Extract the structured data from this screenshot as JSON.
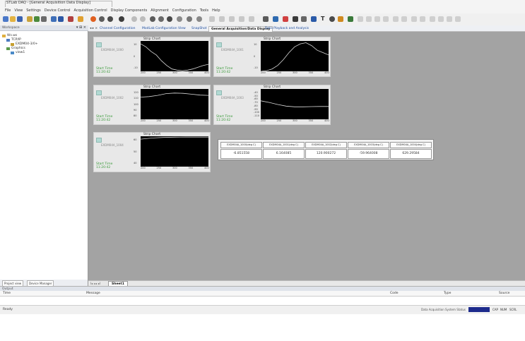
{
  "window": {
    "title": "STLab DAQ - [General Acquisition Data Display]"
  },
  "menu": [
    "File",
    "View",
    "Settings",
    "Device Control",
    "Acquisition Control",
    "Display Components",
    "Alignment",
    "Configuration",
    "Tools",
    "Help"
  ],
  "toolbar_icons": [
    "new-icon",
    "open-icon",
    "save-icon",
    "device-icon",
    "instrument-icon",
    "graph-icon",
    "grid-icon",
    "record-icon",
    "gauge-icon",
    "gauge-icon",
    "gauge-icon",
    "gauge-icon",
    "gauge-icon",
    "gauge-icon",
    "gauge-icon",
    "gauge-icon",
    "gauge-icon",
    "gauge-icon",
    "gauge-icon",
    "align-icon",
    "align-icon",
    "align-icon",
    "align-icon",
    "text-icon",
    "settings-icon",
    "indicator-icon",
    "meter-icon"
  ],
  "left_panel": {
    "header": "Workspace",
    "tree": [
      {
        "label": "Ws.ws"
      },
      {
        "label": "TCP/IP"
      },
      {
        "label": "EXDM04-3/0+"
      },
      {
        "label": "Graphics"
      },
      {
        "label": "view1"
      }
    ],
    "bottom_tabs": [
      "Project view",
      "Device Manager"
    ]
  },
  "doc_tabs": [
    {
      "label": "Channel Configuration"
    },
    {
      "label": "ModLab Configuration View"
    },
    {
      "label": "SnapShot"
    },
    {
      "label": "General Acquisition/Data Display",
      "active": true
    },
    {
      "label": "Data Playback and Analysis"
    }
  ],
  "charts": [
    {
      "title": "Strip Chart",
      "tag": "EXDM04A_1000",
      "start_label": "Start Time",
      "start_value": "11:20:42",
      "y_ticks": [
        "10",
        "0",
        "-10"
      ],
      "x_ticks": [
        "200",
        "250",
        "300",
        "350",
        "400"
      ],
      "values": [
        10.5,
        8,
        4,
        1,
        -4,
        -8,
        -11,
        -12,
        -12.5,
        -12,
        -11,
        -9.5,
        -8,
        -7
      ]
    },
    {
      "title": "Strip Chart",
      "tag": "EXDM04A_1001",
      "start_label": "Start Time",
      "start_value": "11:20:42",
      "y_ticks": [
        "10",
        "0",
        "-10"
      ],
      "x_ticks": [
        "200",
        "250",
        "300",
        "350",
        "400"
      ],
      "values": [
        -13,
        -12.5,
        -11,
        -8,
        -3,
        3,
        8,
        10.5,
        11.5,
        9,
        5,
        3,
        1
      ]
    },
    {
      "title": "Strip Chart",
      "tag": "EXDM04A_1002",
      "start_label": "Start Time",
      "start_value": "11:20:42",
      "y_ticks": [
        "120",
        "110",
        "100",
        "90",
        "80"
      ],
      "x_ticks": [
        "200",
        "250",
        "300",
        "350",
        "400"
      ],
      "values": [
        112,
        113,
        115,
        118,
        119,
        118.5,
        117,
        115.5,
        115
      ]
    },
    {
      "title": "Strip Chart",
      "tag": "EXDM04A_1003",
      "start_label": "Start Time",
      "start_value": "11:20:42",
      "y_ticks": [
        "-40",
        "-50",
        "-60",
        "-70",
        "-80",
        "-90",
        "-100",
        "-110"
      ],
      "x_ticks": [
        "200",
        "250",
        "300",
        "350",
        "400"
      ],
      "values": [
        -65,
        -70,
        -76,
        -81,
        -83,
        -83,
        -82.5,
        -82,
        -82
      ]
    },
    {
      "title": "Strip Chart",
      "tag": "EXDM04A_1004",
      "start_label": "Start Time",
      "start_value": "11:20:42",
      "y_ticks": [
        "60",
        "50",
        "40"
      ],
      "x_ticks": [
        "200",
        "250",
        "300",
        "350",
        "400"
      ],
      "values": [
        60.5,
        61.5,
        62,
        62.2,
        62.3,
        62.3,
        62.3
      ]
    }
  ],
  "table": {
    "columns": [
      "EXDM04A_1000(deg C)",
      "EXDM04A_1001(deg C)",
      "EXDM04A_1002(deg C)",
      "EXDM04A_1003(deg C)",
      "EXDM04A_1004(deg C)"
    ],
    "values": [
      "-6.851558",
      "6.164085",
      "120.900272",
      "-59.964008",
      "629.29584"
    ]
  },
  "sheet": {
    "tab": "Sheet1",
    "arrows": "I◂ ◂ ▸ ▸I"
  },
  "output": {
    "header": "Output",
    "columns": [
      "Time",
      "Message",
      "Code",
      "Type",
      "Source"
    ]
  },
  "status": {
    "left": "Ready",
    "system_label": "Data Acquisition System Status",
    "system_value": "",
    "indicators": [
      "CAP",
      "NUM",
      "SCRL"
    ]
  }
}
